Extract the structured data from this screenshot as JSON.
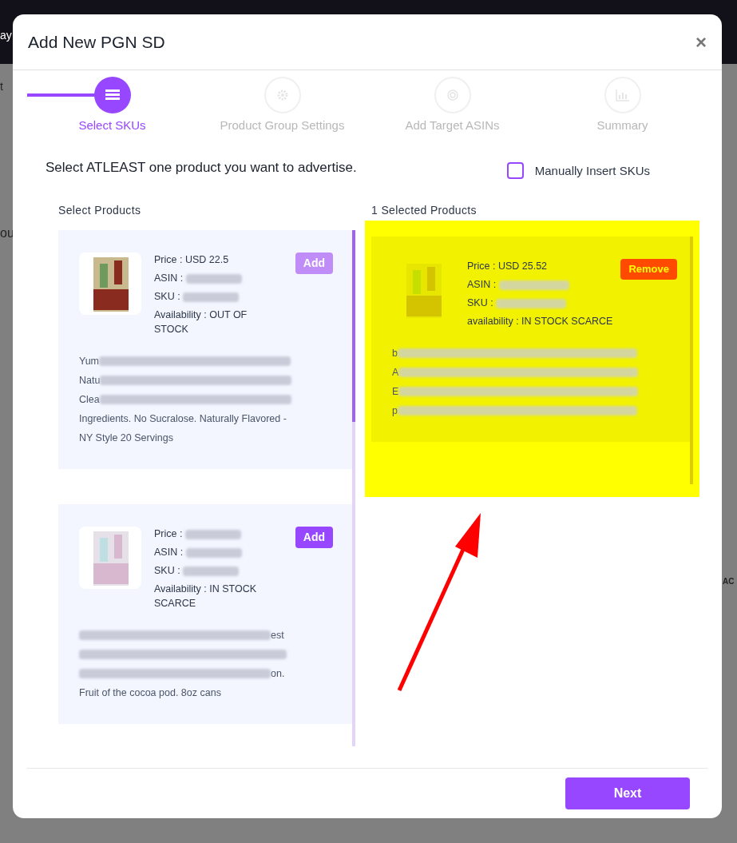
{
  "backdrop": {
    "texts": [
      "ay",
      "t",
      "ou",
      "AC"
    ]
  },
  "modal": {
    "title": "Add New PGN SD",
    "close": "×"
  },
  "steps": [
    {
      "label": "Select SKUs",
      "selected": true
    },
    {
      "label": "Product Group Settings",
      "selected": false
    },
    {
      "label": "Add Target ASINs",
      "selected": false
    },
    {
      "label": "Summary",
      "selected": false
    }
  ],
  "instruction": "Select ATLEAST one product you want to advertise.",
  "manual_insert": {
    "label": "Manually Insert SKUs",
    "checked": false
  },
  "available": {
    "heading": "Select Products",
    "products": [
      {
        "button": "Add",
        "disabled": true,
        "fields": [
          {
            "label": "Price : USD 22.5",
            "redacted": false
          },
          {
            "label": "ASIN :",
            "redacted": true
          },
          {
            "label": "SKU :",
            "redacted": true
          },
          {
            "label": "Availability : OUT OF STOCK",
            "redacted": false
          }
        ],
        "description": [
          {
            "text": "Yum",
            "kind": "text_then_blur"
          },
          {
            "text": "Natu",
            "kind": "text_then_blur"
          },
          {
            "text": "Clea",
            "kind": "text_then_blur"
          },
          {
            "text": "Ingredients. No Sucralose. Naturally Flavored -",
            "kind": "plain"
          },
          {
            "text": "NY Style 20 Servings",
            "kind": "plain"
          }
        ]
      },
      {
        "button": "Add",
        "disabled": false,
        "fields": [
          {
            "label": "Price :",
            "redacted": true
          },
          {
            "label": "ASIN :",
            "redacted": true
          },
          {
            "label": "SKU :",
            "redacted": true
          },
          {
            "label": "Availability : IN STOCK SCARCE",
            "redacted": false
          }
        ],
        "description": [
          {
            "text": "est",
            "kind": "blur_then_text"
          },
          {
            "kind": "blur"
          },
          {
            "text": "on.",
            "kind": "blur_then_text"
          },
          {
            "text": "Fruit of the cocoa pod. 8oz cans",
            "kind": "plain"
          }
        ]
      }
    ]
  },
  "selected": {
    "heading": "1 Selected Products",
    "highlighted": true,
    "products": [
      {
        "button": "Remove",
        "fields": [
          {
            "label": "Price : USD 25.52",
            "redacted": false
          },
          {
            "label": "ASIN :",
            "redacted": true
          },
          {
            "label": "SKU :",
            "redacted": true
          },
          {
            "label": "availability : IN STOCK SCARCE",
            "redacted": false
          }
        ],
        "description": [
          {
            "text": "b",
            "kind": "text_then_blur"
          },
          {
            "text": "A",
            "kind": "text_then_blur"
          },
          {
            "text": "E",
            "kind": "text_then_blur"
          },
          {
            "text": "p",
            "kind": "text_then_blur"
          }
        ]
      }
    ]
  },
  "footer": {
    "next": "Next"
  }
}
